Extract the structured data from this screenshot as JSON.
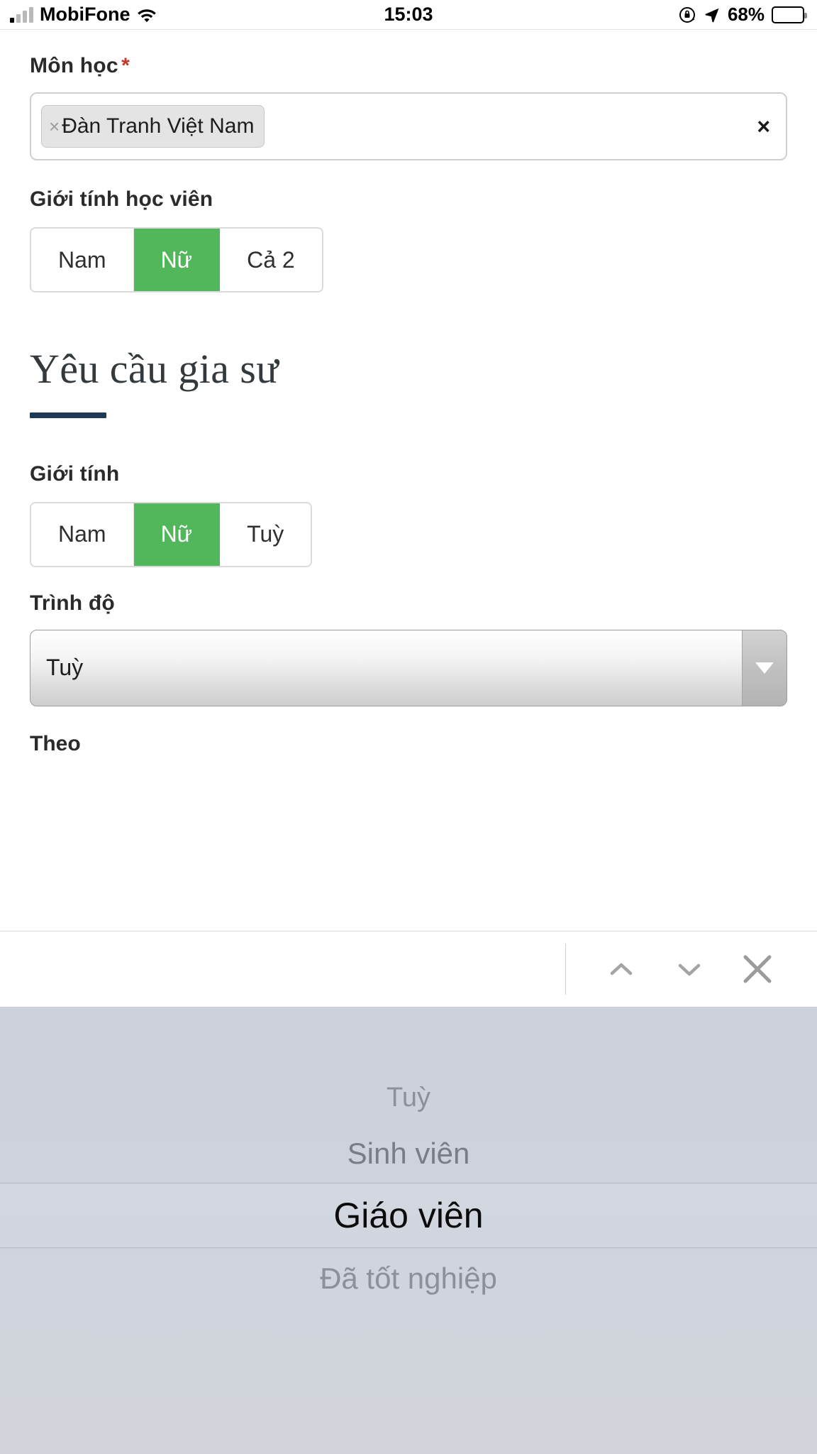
{
  "status_bar": {
    "carrier": "MobiFone",
    "time": "15:03",
    "battery_percent": "68%",
    "icons": {
      "signal": "signal-bars-icon",
      "wifi": "wifi-icon",
      "rotation_lock": "rotation-lock-icon",
      "location": "location-arrow-icon",
      "battery": "battery-icon"
    }
  },
  "form": {
    "subject": {
      "label": "Môn học",
      "required_marker": "*",
      "tags": [
        {
          "remove_label": "×",
          "text": "Đàn Tranh Việt Nam"
        }
      ],
      "clear_label": "×"
    },
    "student_gender": {
      "label": "Giới tính học viên",
      "options": [
        "Nam",
        "Nữ",
        "Cả 2"
      ],
      "selected": "Nữ"
    }
  },
  "section": {
    "title": "Yêu cầu gia sư",
    "tutor_gender": {
      "label": "Giới tính",
      "options": [
        "Nam",
        "Nữ",
        "Tuỳ"
      ],
      "selected": "Nữ"
    },
    "level": {
      "label": "Trình độ",
      "value": "Tuỳ",
      "caret": "▼"
    },
    "theo": {
      "label": "Theo"
    }
  },
  "accessory_toolbar": {
    "prev_label": "chevron-up-icon",
    "next_label": "chevron-down-icon",
    "done_label": "close-icon"
  },
  "picker": {
    "options": [
      "Tuỳ",
      "Sinh viên",
      "Giáo viên",
      "Đã tốt nghiệp"
    ],
    "selected": "Giáo viên",
    "rows": {
      "r0": "Tuỳ",
      "r1": "Sinh viên",
      "r2": "Giáo viên",
      "r3": "Đã tốt nghiệp"
    }
  },
  "colors": {
    "accent_green": "#52b65b",
    "rule_navy": "#1f3a56",
    "required_red": "#c0392b",
    "picker_bg": "#ced2db"
  }
}
